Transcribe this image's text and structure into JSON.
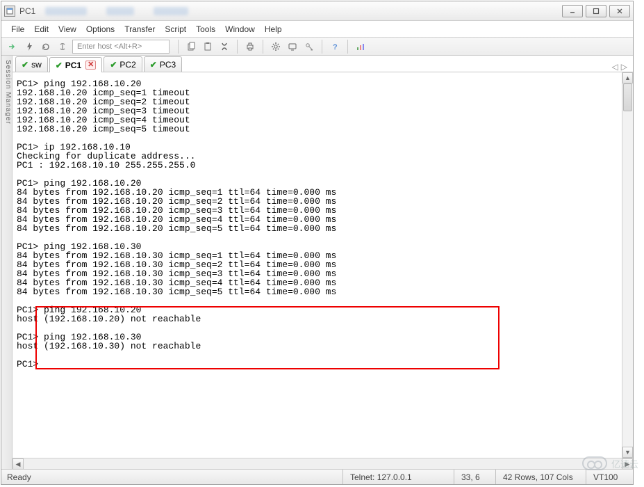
{
  "window": {
    "title": "PC1"
  },
  "menu": {
    "file": "File",
    "edit": "Edit",
    "view": "View",
    "options": "Options",
    "transfer": "Transfer",
    "script": "Script",
    "tools": "Tools",
    "window": "Window",
    "help": "Help"
  },
  "toolbar": {
    "host_placeholder": "Enter host <Alt+R>"
  },
  "sidepanel_label": "Session Manager",
  "tabs": [
    {
      "label": "sw",
      "active": false,
      "has_close": false
    },
    {
      "label": "PC1",
      "active": true,
      "has_close": true
    },
    {
      "label": "PC2",
      "active": false,
      "has_close": false
    },
    {
      "label": "PC3",
      "active": false,
      "has_close": false
    }
  ],
  "terminal_text": "PC1> ping 192.168.10.20\n192.168.10.20 icmp_seq=1 timeout\n192.168.10.20 icmp_seq=2 timeout\n192.168.10.20 icmp_seq=3 timeout\n192.168.10.20 icmp_seq=4 timeout\n192.168.10.20 icmp_seq=5 timeout\n\nPC1> ip 192.168.10.10\nChecking for duplicate address...\nPC1 : 192.168.10.10 255.255.255.0\n\nPC1> ping 192.168.10.20\n84 bytes from 192.168.10.20 icmp_seq=1 ttl=64 time=0.000 ms\n84 bytes from 192.168.10.20 icmp_seq=2 ttl=64 time=0.000 ms\n84 bytes from 192.168.10.20 icmp_seq=3 ttl=64 time=0.000 ms\n84 bytes from 192.168.10.20 icmp_seq=4 ttl=64 time=0.000 ms\n84 bytes from 192.168.10.20 icmp_seq=5 ttl=64 time=0.000 ms\n\nPC1> ping 192.168.10.30\n84 bytes from 192.168.10.30 icmp_seq=1 ttl=64 time=0.000 ms\n84 bytes from 192.168.10.30 icmp_seq=2 ttl=64 time=0.000 ms\n84 bytes from 192.168.10.30 icmp_seq=3 ttl=64 time=0.000 ms\n84 bytes from 192.168.10.30 icmp_seq=4 ttl=64 time=0.000 ms\n84 bytes from 192.168.10.30 icmp_seq=5 ttl=64 time=0.000 ms\n\nPC1> ping 192.168.10.20\nhost (192.168.10.20) not reachable\n\nPC1> ping 192.168.10.30\nhost (192.168.10.30) not reachable\n\nPC1>",
  "statusbar": {
    "ready": "Ready",
    "telnet": "Telnet: 127.0.0.1",
    "cursor": "33,  6",
    "dims": "42 Rows, 107 Cols",
    "termtype": "VT100"
  },
  "watermark_text": "亿速云"
}
